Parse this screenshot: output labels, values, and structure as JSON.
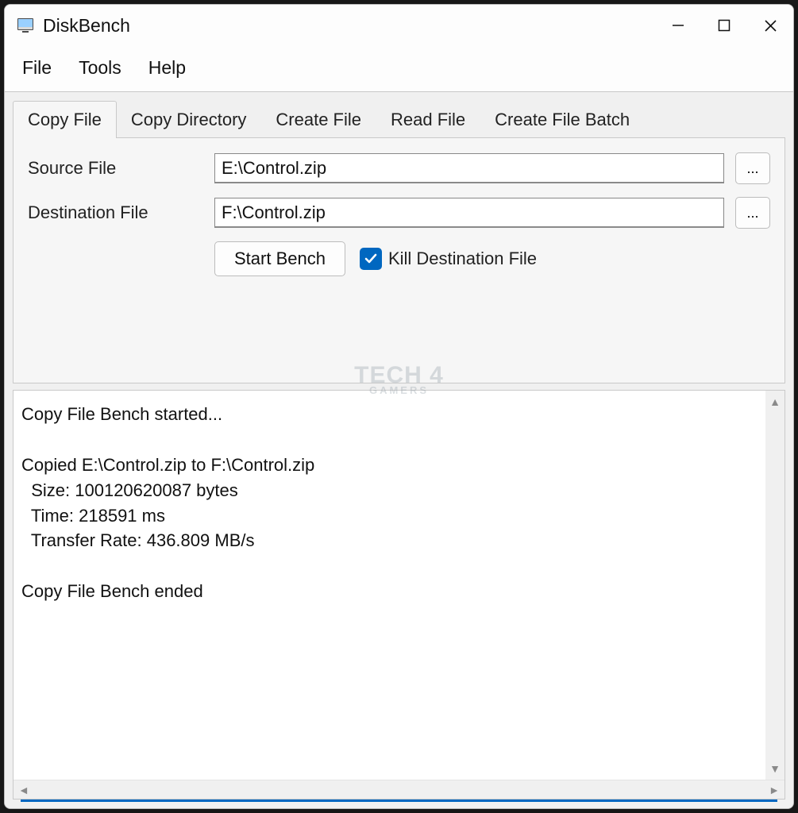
{
  "window": {
    "title": "DiskBench"
  },
  "menu": {
    "file": "File",
    "tools": "Tools",
    "help": "Help"
  },
  "tabs": {
    "copy_file": "Copy File",
    "copy_directory": "Copy Directory",
    "create_file": "Create File",
    "read_file": "Read File",
    "create_file_batch": "Create File Batch"
  },
  "form": {
    "source_label": "Source File",
    "source_value": "E:\\Control.zip",
    "dest_label": "Destination File",
    "dest_value": "F:\\Control.zip",
    "browse": "...",
    "start_bench": "Start Bench",
    "kill_dest": "Kill Destination File"
  },
  "output": {
    "text": "Copy File Bench started...\n\nCopied E:\\Control.zip to F:\\Control.zip\n  Size: 100120620087 bytes\n  Time: 218591 ms\n  Transfer Rate: 436.809 MB/s\n\nCopy File Bench ended"
  },
  "watermark": {
    "line1": "TECH 4",
    "line2": "GAMERS"
  }
}
